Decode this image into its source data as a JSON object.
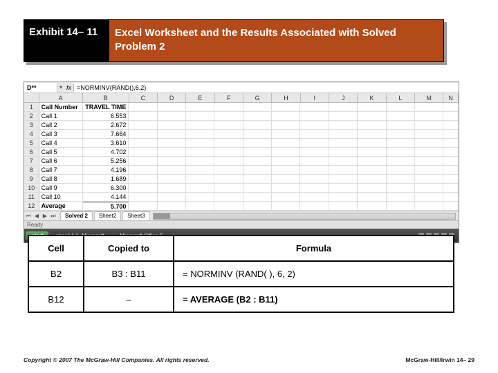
{
  "title": {
    "label": "Exhibit 14– 11",
    "text": "Excel Worksheet and the Results Associated with Solved Problem 2"
  },
  "excel": {
    "name_box": "D**",
    "fx_label": "fx",
    "formula": "=NORMINV(RAND(),6,2)",
    "col_headers": {
      "A": "A",
      "B": "B",
      "C": "C",
      "D": "D",
      "E": "E",
      "F": "F",
      "G": "G",
      "H": "H",
      "I": "I",
      "J": "J",
      "K": "K",
      "L": "L",
      "M": "M",
      "N": "N"
    },
    "rows": [
      {
        "n": "1",
        "a": "Call Number",
        "b": "TRAVEL TIME",
        "bold": true
      },
      {
        "n": "2",
        "a": "Call 1",
        "b": "6.553"
      },
      {
        "n": "3",
        "a": "Call 2",
        "b": "2.672"
      },
      {
        "n": "4",
        "a": "Call 3",
        "b": "7.664"
      },
      {
        "n": "5",
        "a": "Call 4",
        "b": "3.610"
      },
      {
        "n": "6",
        "a": "Call 5",
        "b": "4.702"
      },
      {
        "n": "7",
        "a": "Call 6",
        "b": "5.256"
      },
      {
        "n": "8",
        "a": "Call 7",
        "b": "4.196"
      },
      {
        "n": "9",
        "a": "Call 8",
        "b": "1.689"
      },
      {
        "n": "10",
        "a": "Call 9",
        "b": "6.300"
      },
      {
        "n": "11",
        "a": "Call 10",
        "b": "4.144"
      },
      {
        "n": "12",
        "a": "Average",
        "b": "5.700",
        "bold": true
      }
    ],
    "tabs": {
      "active": "Solved 2",
      "t2": "Sheet2",
      "t3": "Sheet3"
    },
    "status": "Ready",
    "taskbar": {
      "start": "start",
      "task1": "chap14-1. Microsoft...",
      "task2": "Microsoft Office E..."
    }
  },
  "ftable": {
    "h1": "Cell",
    "h2": "Copied to",
    "h3": "Formula",
    "r1": {
      "cell": "B2",
      "copied": "B3 : B11",
      "formula": "= NORMINV (RAND( ), 6, 2)"
    },
    "r2": {
      "cell": "B12",
      "copied": "–",
      "formula": "= AVERAGE (B2 : B11)"
    }
  },
  "footer": {
    "left": "Copyright © 2007 The McGraw-Hill Companies. All rights reserved.",
    "right": "McGraw-Hill/Irwin   14– 29"
  }
}
